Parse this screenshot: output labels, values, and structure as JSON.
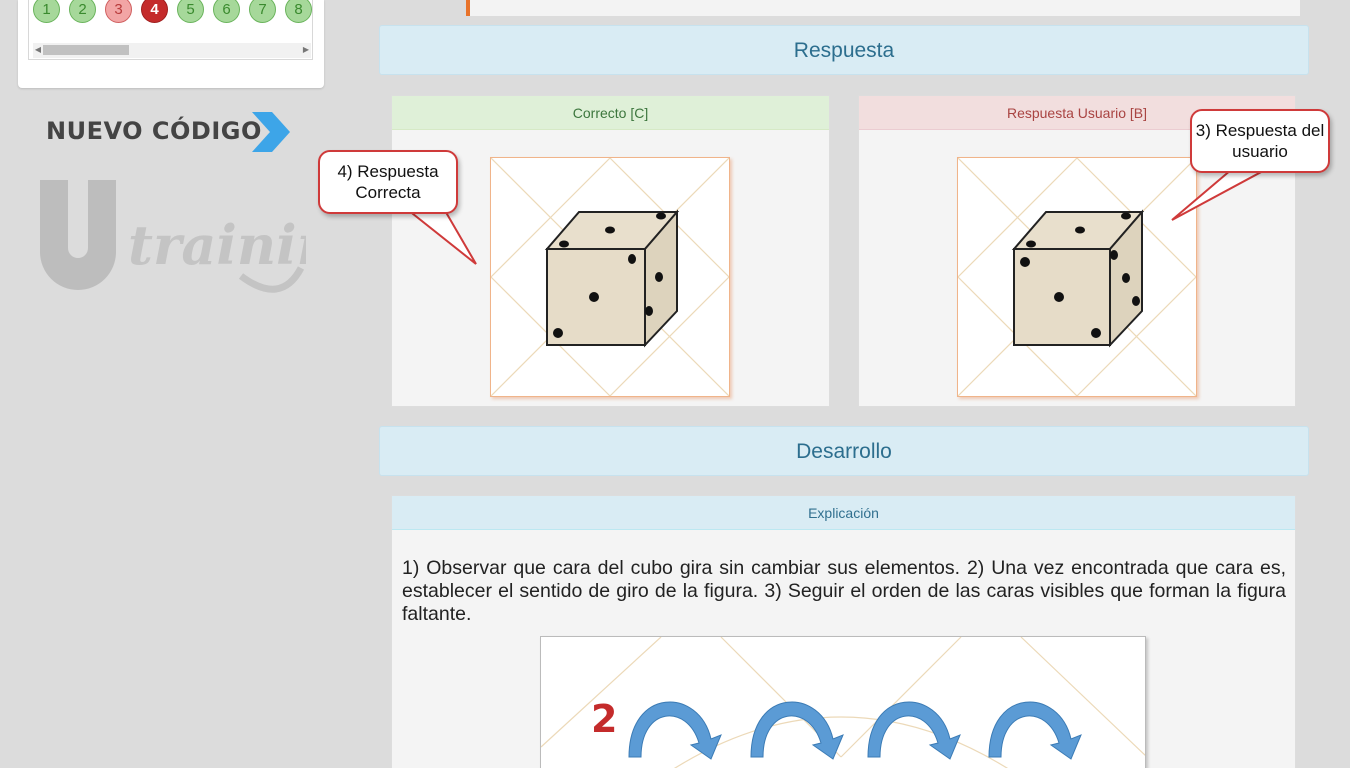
{
  "question_nav": {
    "buttons": [
      {
        "label": "1",
        "state": "ok"
      },
      {
        "label": "2",
        "state": "ok"
      },
      {
        "label": "3",
        "state": "bad"
      },
      {
        "label": "4",
        "state": "cur"
      },
      {
        "label": "5",
        "state": "ok"
      },
      {
        "label": "6",
        "state": "ok"
      },
      {
        "label": "7",
        "state": "ok"
      },
      {
        "label": "8",
        "state": "ok"
      }
    ]
  },
  "sidebar": {
    "brand_text": "NUEVO CÓDIGO",
    "watermark_text": "training"
  },
  "respuesta": {
    "title": "Respuesta",
    "correct_label": "Correcto [C]",
    "user_label": "Respuesta Usuario [B]"
  },
  "callouts": {
    "correct": "4) Respuesta Correcta",
    "user": "3) Respuesta del usuario"
  },
  "desarrollo": {
    "title": "Desarrollo",
    "panel_title": "Explicación",
    "text": "1) Observar que cara del cubo gira sin cambiar sus elementos. 2) Una vez encontrada que cara es, establecer el sentido de giro de la figura. 3) Seguir el orden de las caras visibles que forman la figura faltante.",
    "image_step_label": "2"
  },
  "colors": {
    "accent_orange": "#e8732a",
    "header_blue": "#d9ecf4",
    "ok_green": "#dff0d8",
    "bad_red": "#f2dede",
    "callout_red": "#cf3a3a",
    "arrow_blue": "#5b9bd5"
  }
}
